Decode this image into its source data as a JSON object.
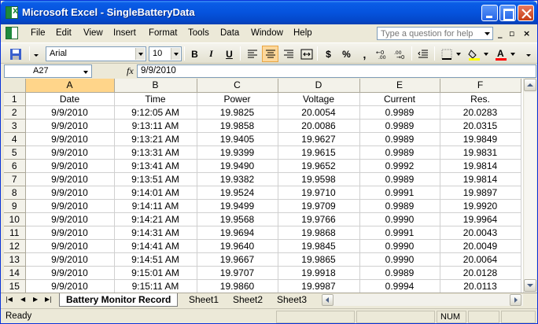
{
  "window": {
    "title": "Microsoft Excel - SingleBatteryData"
  },
  "app_icon_text": "X",
  "menu": [
    "File",
    "Edit",
    "View",
    "Insert",
    "Format",
    "Tools",
    "Data",
    "Window",
    "Help"
  ],
  "help": {
    "placeholder": "Type a question for help"
  },
  "toolbar": {
    "font": "Arial",
    "size": "10",
    "bold": "B",
    "italic": "I",
    "underline": "U",
    "currency": "$",
    "percent": "%",
    "comma": ","
  },
  "formula": {
    "cell": "A27",
    "fx": "fx",
    "value": "9/9/2010"
  },
  "columns": [
    "A",
    "B",
    "C",
    "D",
    "E",
    "F"
  ],
  "sheet": {
    "header": [
      "Date",
      "Time",
      "Power",
      "Voltage",
      "Current",
      "Res."
    ],
    "rows": [
      [
        "9/9/2010",
        "9:12:05 AM",
        "19.9825",
        "20.0054",
        "0.9989",
        "20.0283"
      ],
      [
        "9/9/2010",
        "9:13:11 AM",
        "19.9858",
        "20.0086",
        "0.9989",
        "20.0315"
      ],
      [
        "9/9/2010",
        "9:13:21 AM",
        "19.9405",
        "19.9627",
        "0.9989",
        "19.9849"
      ],
      [
        "9/9/2010",
        "9:13:31 AM",
        "19.9399",
        "19.9615",
        "0.9989",
        "19.9831"
      ],
      [
        "9/9/2010",
        "9:13:41 AM",
        "19.9490",
        "19.9652",
        "0.9992",
        "19.9814"
      ],
      [
        "9/9/2010",
        "9:13:51 AM",
        "19.9382",
        "19.9598",
        "0.9989",
        "19.9814"
      ],
      [
        "9/9/2010",
        "9:14:01 AM",
        "19.9524",
        "19.9710",
        "0.9991",
        "19.9897"
      ],
      [
        "9/9/2010",
        "9:14:11 AM",
        "19.9499",
        "19.9709",
        "0.9989",
        "19.9920"
      ],
      [
        "9/9/2010",
        "9:14:21 AM",
        "19.9568",
        "19.9766",
        "0.9990",
        "19.9964"
      ],
      [
        "9/9/2010",
        "9:14:31 AM",
        "19.9694",
        "19.9868",
        "0.9991",
        "20.0043"
      ],
      [
        "9/9/2010",
        "9:14:41 AM",
        "19.9640",
        "19.9845",
        "0.9990",
        "20.0049"
      ],
      [
        "9/9/2010",
        "9:14:51 AM",
        "19.9667",
        "19.9865",
        "0.9990",
        "20.0064"
      ],
      [
        "9/9/2010",
        "9:15:01 AM",
        "19.9707",
        "19.9918",
        "0.9989",
        "20.0128"
      ],
      [
        "9/9/2010",
        "9:15:11 AM",
        "19.9860",
        "19.9987",
        "0.9994",
        "20.0113"
      ]
    ]
  },
  "row_numbers": [
    "1",
    "2",
    "3",
    "4",
    "5",
    "6",
    "7",
    "8",
    "9",
    "10",
    "11",
    "12",
    "13",
    "14",
    "15"
  ],
  "tabs": [
    "Battery Monitor Record",
    "Sheet1",
    "Sheet2",
    "Sheet3"
  ],
  "status": {
    "text": "Ready",
    "num": "NUM"
  },
  "colors": {
    "title_bar": "#0553dd",
    "active_cell_header": "#ffd58a",
    "toolbar_highlight": "#fdd79a"
  }
}
